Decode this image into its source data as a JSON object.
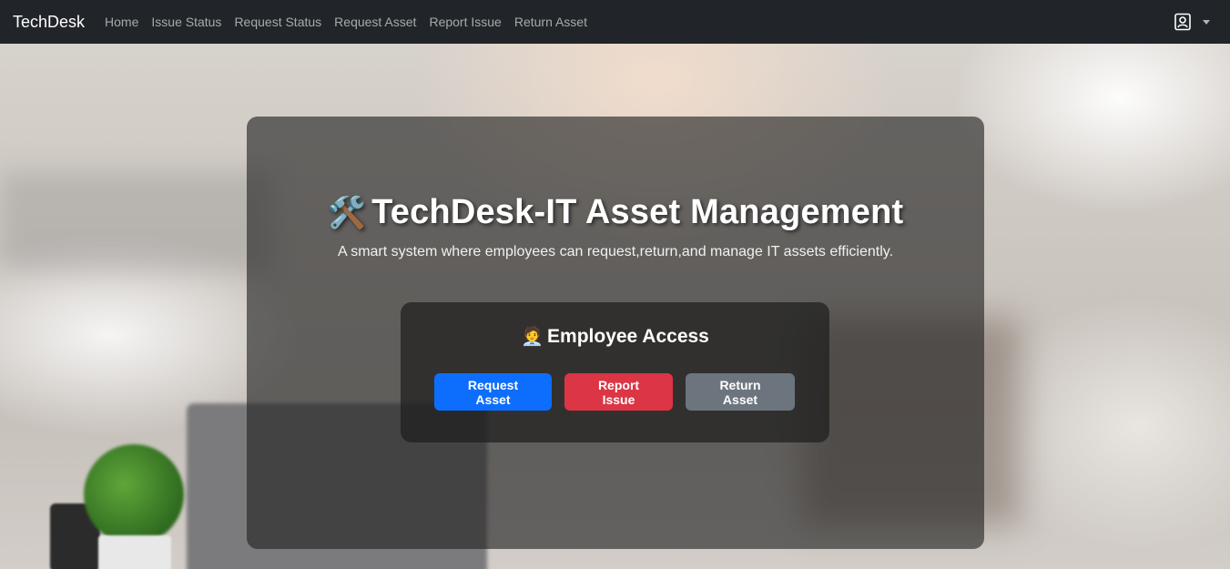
{
  "navbar": {
    "brand": "TechDesk",
    "links": [
      "Home",
      "Issue Status",
      "Request Status",
      "Request Asset",
      "Report Issue",
      "Return Asset"
    ],
    "user_icon": "user-contact-icon",
    "dropdown_icon": "caret-down-icon"
  },
  "hero": {
    "title_icon": "🛠️",
    "title": "TechDesk-IT Asset Management",
    "subtitle": "A smart system where employees can request,return,and manage IT assets efficiently.",
    "access": {
      "icon": "🧑‍💼",
      "title": "Employee Access",
      "buttons": [
        {
          "label": "Request Asset",
          "color": "#0d6efd"
        },
        {
          "label": "Report Issue",
          "color": "#dc3545"
        },
        {
          "label": "Return Asset",
          "color": "#6c757d"
        }
      ]
    }
  },
  "colors": {
    "navbar_bg": "#212529",
    "card_bg": "rgba(33,33,33,0.62)"
  }
}
